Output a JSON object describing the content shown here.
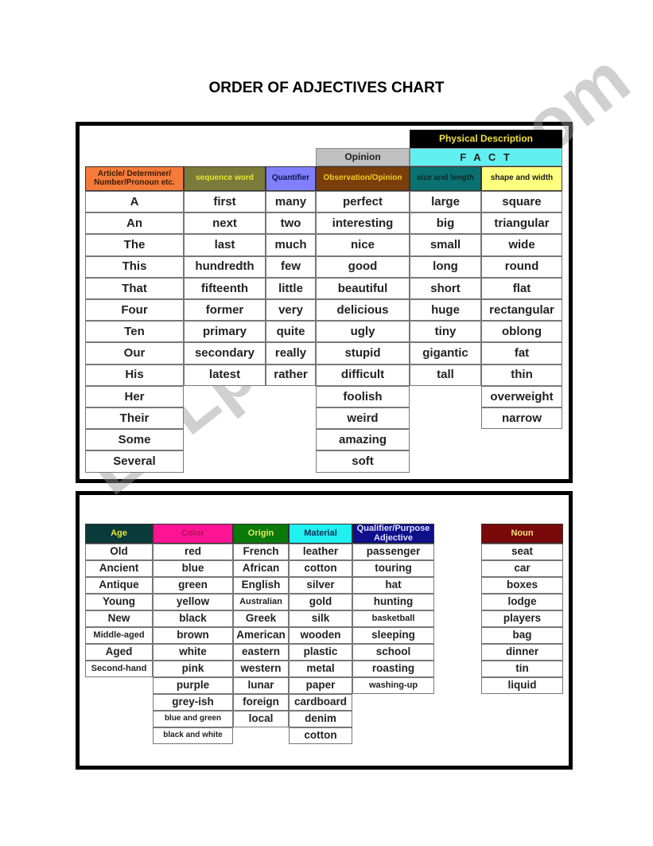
{
  "title": "ORDER OF ADJECTIVES CHART",
  "watermark": "ESLprintables.com",
  "top_table": {
    "group_headers": {
      "physical": "Physical Description",
      "opinion": "Opinion",
      "fact": "F A C T"
    },
    "columns": [
      {
        "header": "Article/ Determiner/ Number/Pronoun etc.",
        "bg": "#f47b3c",
        "fg": "#3a1a00",
        "items": [
          "A",
          "An",
          "The",
          "This",
          "That",
          "Four",
          "Ten",
          "Our",
          "His",
          "Her",
          "Their",
          "Some",
          "Several"
        ]
      },
      {
        "header": "sequence word",
        "bg": "#7a7a3a",
        "fg": "#e8e830",
        "items": [
          "first",
          "next",
          "last",
          "hundredth",
          "fifteenth",
          "former",
          "primary",
          "secondary",
          "latest"
        ]
      },
      {
        "header": "Quantifier",
        "bg": "#8080ff",
        "fg": "#101050",
        "items": [
          "many",
          "two",
          "much",
          "few",
          "little",
          "very",
          "quite",
          "really",
          "rather"
        ]
      },
      {
        "header": "Observation/Opinion",
        "bg": "#7a3e0a",
        "fg": "#f0d020",
        "items": [
          "perfect",
          "interesting",
          "nice",
          "good",
          "beautiful",
          "delicious",
          "ugly",
          "stupid",
          "difficult",
          "foolish",
          "weird",
          "amazing",
          "soft"
        ]
      },
      {
        "header": "size and length",
        "bg": "#0a7070",
        "fg": "#0a2a2a",
        "items": [
          "large",
          "big",
          "small",
          "long",
          "short",
          "huge",
          "tiny",
          "gigantic",
          "tall"
        ]
      },
      {
        "header": "shape and width",
        "bg": "#ffff80",
        "fg": "#202020",
        "items": [
          "square",
          "triangular",
          "wide",
          "round",
          "flat",
          "rectangular",
          "oblong",
          "fat",
          "thin",
          "overweight",
          "narrow"
        ]
      }
    ]
  },
  "bottom_table": {
    "columns": [
      {
        "header": "Age",
        "bg": "#0a3a3a",
        "fg": "#e8e830",
        "items": [
          "Old",
          "Ancient",
          "Antique",
          "Young",
          "New",
          "Middle-aged",
          "Aged",
          "Second-hand"
        ]
      },
      {
        "header": "Color",
        "bg": "#ff1493",
        "fg": "#b01060",
        "items": [
          "red",
          "blue",
          "green",
          "yellow",
          "black",
          "brown",
          "white",
          "pink",
          "purple",
          "grey-ish",
          "blue and green",
          "black and white"
        ]
      },
      {
        "header": "Origin",
        "bg": "#0a7a0a",
        "fg": "#e8e860",
        "items": [
          "French",
          "African",
          "English",
          "Australian",
          "Greek",
          "American",
          "eastern",
          "western",
          "lunar",
          "foreign",
          "local"
        ]
      },
      {
        "header": "Material",
        "bg": "#20f0f0",
        "fg": "#103060",
        "items": [
          "leather",
          "cotton",
          "silver",
          "gold",
          "silk",
          "wooden",
          "plastic",
          "metal",
          "paper",
          "cardboard",
          "denim",
          "cotton"
        ]
      },
      {
        "header": "Qualifier/Purpose Adjective",
        "bg": "#10108a",
        "fg": "#e0e0ff",
        "items": [
          "passenger",
          "touring",
          "hat",
          "hunting",
          "basketball",
          "sleeping",
          "school",
          "roasting",
          "washing-up"
        ]
      },
      {
        "header": "Noun",
        "bg": "#7a0a0a",
        "fg": "#f0e080",
        "items": [
          "seat",
          "car",
          "boxes",
          "lodge",
          "players",
          "bag",
          "dinner",
          "tin",
          "liquid"
        ]
      }
    ]
  }
}
